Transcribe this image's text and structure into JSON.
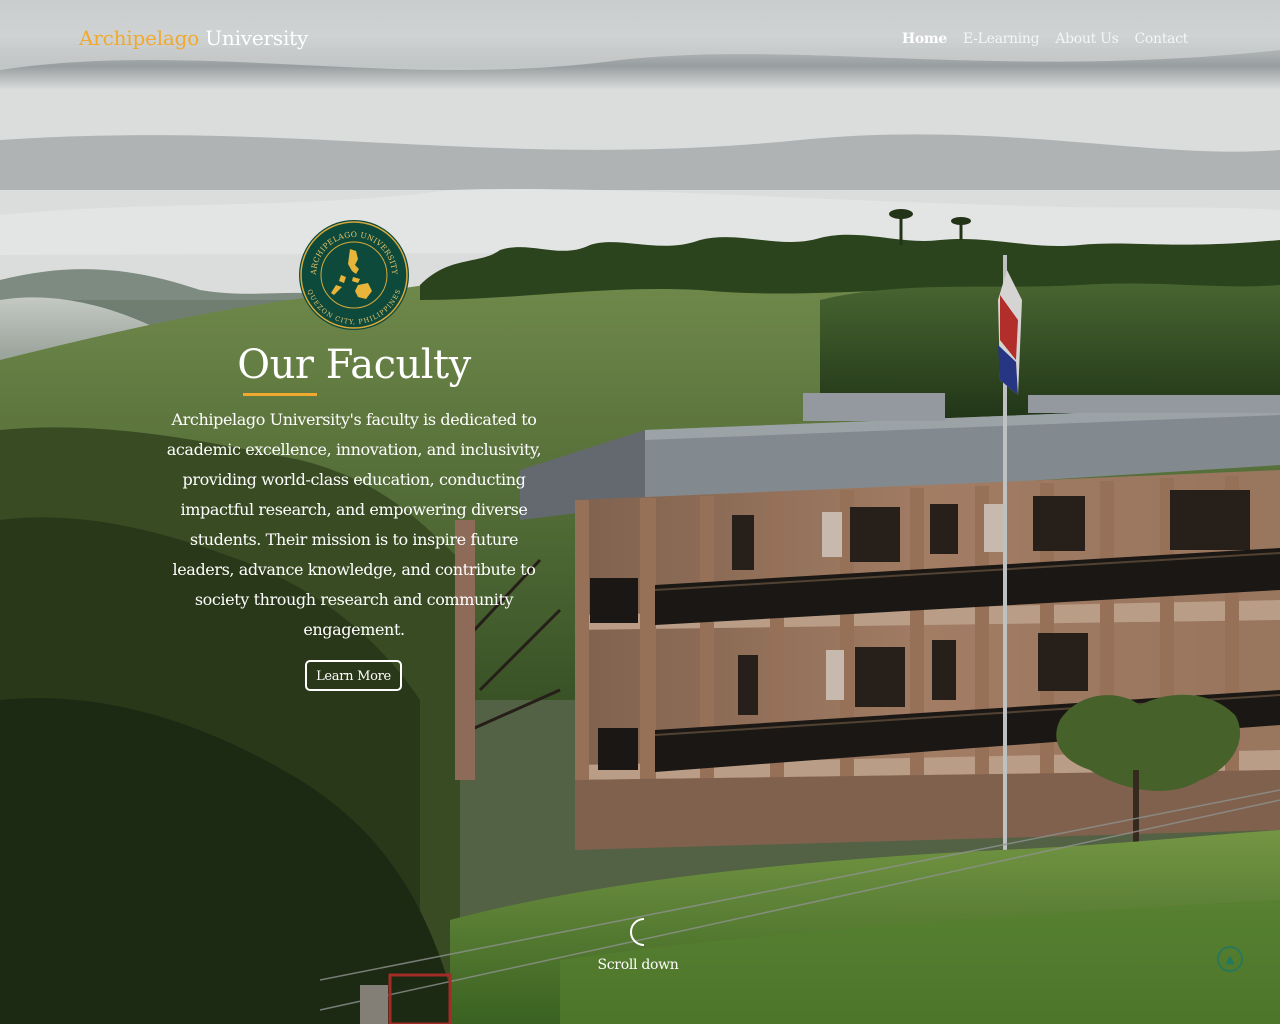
{
  "brand": {
    "part1": "Archipelago",
    "part2": "University"
  },
  "nav": {
    "items": [
      {
        "label": "Home",
        "active": true
      },
      {
        "label": "E-Learning",
        "active": false
      },
      {
        "label": "About Us",
        "active": false
      },
      {
        "label": "Contact",
        "active": false
      }
    ]
  },
  "seal": {
    "top_text": "ARCHIPELAGO UNIVERSITY",
    "bottom_text": "QUEZON CITY, PHILIPPINES",
    "icon": "philippines-map-icon"
  },
  "hero": {
    "title": "Our Faculty",
    "description": "Archipelago University's faculty is dedicated to academic excellence, innovation, and inclusivity, providing world-class education, conducting impactful research, and empowering diverse students. Their mission is to inspire future leaders, advance knowledge, and contribute to society through research and community engagement.",
    "cta_label": "Learn More"
  },
  "scroll": {
    "label": "Scroll down"
  },
  "colors": {
    "accent": "#f0a92e",
    "seal_green": "#0e4a3b"
  }
}
